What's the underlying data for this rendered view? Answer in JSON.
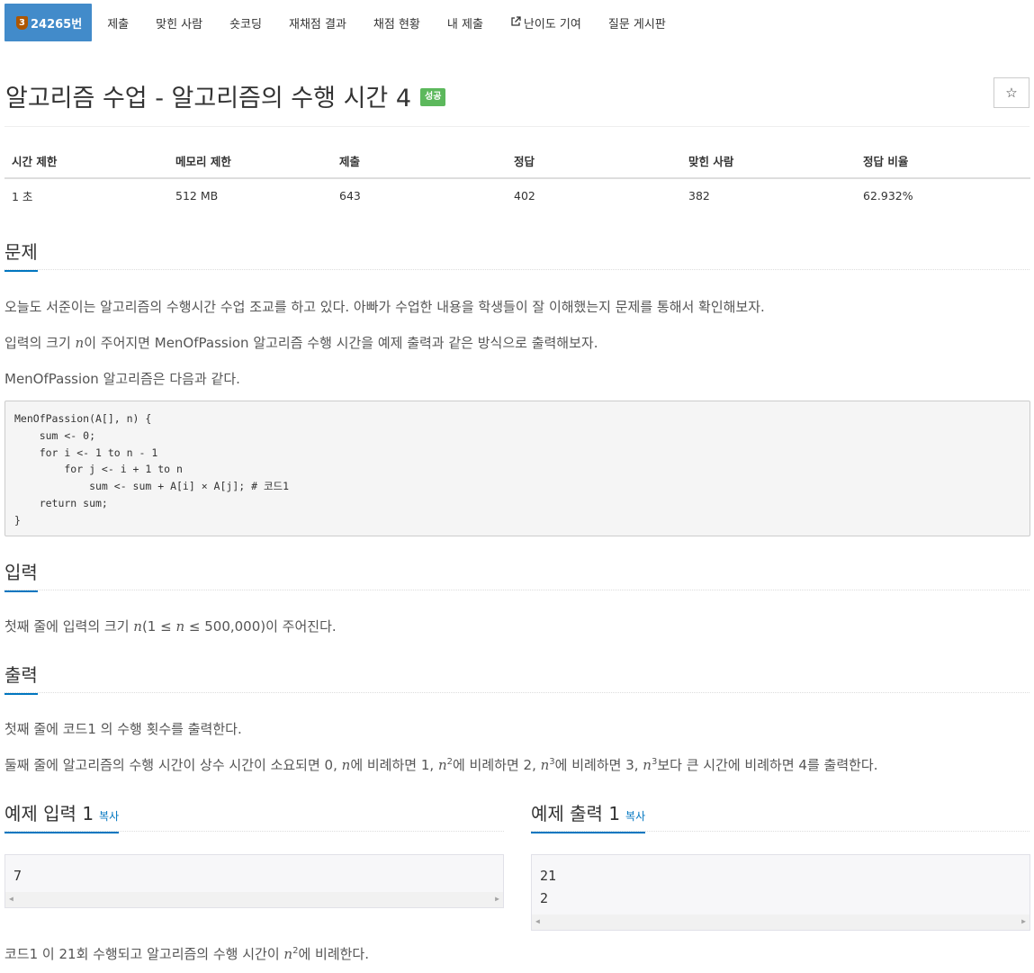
{
  "nav": {
    "tier": "3",
    "problem_id": "24265번",
    "items": [
      "제출",
      "맞힌 사람",
      "숏코딩",
      "재채점 결과",
      "채점 현황",
      "내 제출",
      "난이도 기여",
      "질문 게시판"
    ]
  },
  "title": "알고리즘 수업 - 알고리즘의 수행 시간 4",
  "result_badge": "성공",
  "star": "☆",
  "stats": {
    "headers": [
      "시간 제한",
      "메모리 제한",
      "제출",
      "정답",
      "맞힌 사람",
      "정답 비율"
    ],
    "values": [
      "1 초",
      "512 MB",
      "643",
      "402",
      "382",
      "62.932%"
    ]
  },
  "sections": {
    "problem": "문제",
    "input": "입력",
    "output": "출력",
    "sample_input": "예제 입력 1",
    "sample_output": "예제 출력 1",
    "copy": "복사"
  },
  "problem": {
    "p1": "오늘도 서준이는 알고리즘의 수행시간 수업 조교를 하고 있다. 아빠가 수업한 내용을 학생들이 잘 이해했는지 문제를 통해서 확인해보자.",
    "p2_pre": "입력의 크기 ",
    "p2_var": "n",
    "p2_post": "이 주어지면 MenOfPassion 알고리즘 수행 시간을 예제 출력과 같은 방식으로 출력해보자.",
    "p3": "MenOfPassion 알고리즘은 다음과 같다.",
    "code": "MenOfPassion(A[], n) {\n    sum <- 0;\n    for i <- 1 to n - 1\n        for j <- i + 1 to n\n            sum <- sum + A[i] × A[j]; # 코드1\n    return sum;\n}"
  },
  "input_desc": {
    "pre": "첫째 줄에 입력의 크기 ",
    "var": "n",
    "mid1": "(1 ≤ ",
    "var2": "n",
    "mid2": " ≤ 500,000)이 주어진다."
  },
  "output_desc": {
    "l1": "첫째 줄에 코드1 의 수행 횟수를 출력한다.",
    "l2_a": "둘째 줄에 알고리즘의 수행 시간이 상수 시간이 소요되면 0, ",
    "l2_b": "에 비례하면 1, ",
    "l2_c": "에 비례하면 2, ",
    "l2_d": "에 비례하면 3, ",
    "l2_e": "보다 큰 시간에 비례하면 4를 출력한다.",
    "n": "n",
    "exp2": "2",
    "exp3": "3"
  },
  "sample_input_text": "7",
  "sample_output_text": "21\n2",
  "note": {
    "pre": "코드1 이 21회 수행되고 알고리즘의 수행 시간이 ",
    "var": "n",
    "exp": "2",
    "post": "에 비례한다."
  }
}
